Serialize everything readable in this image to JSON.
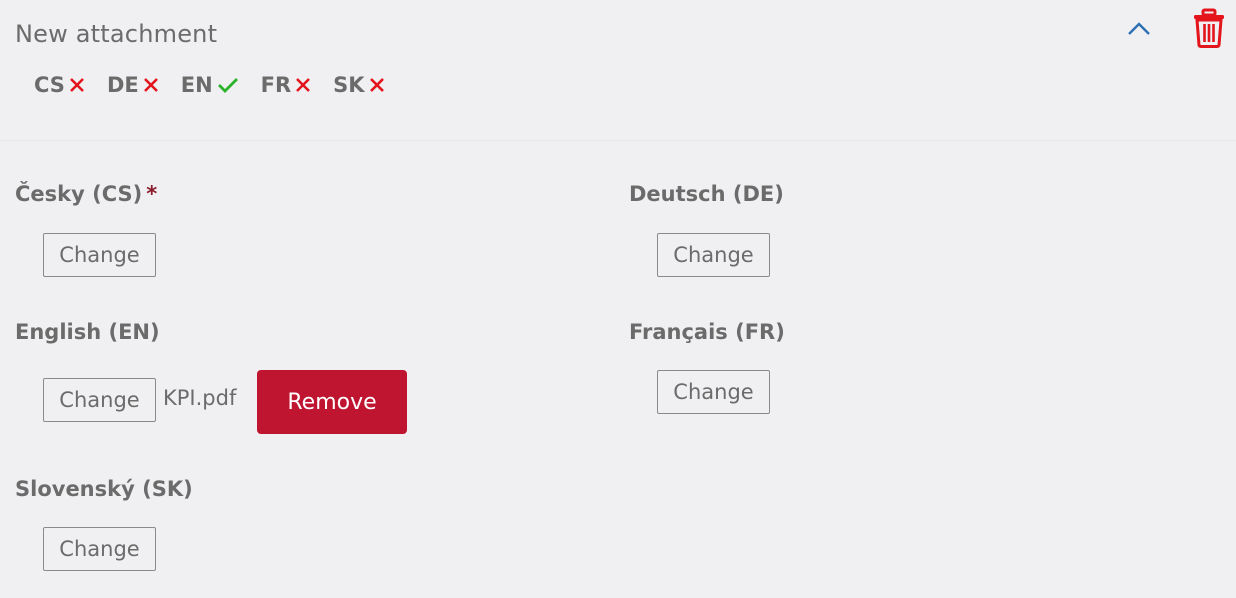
{
  "header": {
    "title": "New attachment",
    "collapse_icon": "chevron-up-icon",
    "delete_icon": "trash-icon",
    "accent_color": "#2f6fb3",
    "danger_color": "#e3141c"
  },
  "languages": [
    {
      "code": "CS",
      "status": "missing"
    },
    {
      "code": "DE",
      "status": "missing"
    },
    {
      "code": "EN",
      "status": "ok"
    },
    {
      "code": "FR",
      "status": "missing"
    },
    {
      "code": "SK",
      "status": "missing"
    }
  ],
  "status_colors": {
    "ok": "#2bb32b",
    "missing": "#e3141c"
  },
  "fields": {
    "cs": {
      "label": "Česky (CS)",
      "required_mark": "*",
      "button": "Change"
    },
    "de": {
      "label": "Deutsch (DE)",
      "button": "Change"
    },
    "en": {
      "label": "English (EN)",
      "button": "Change",
      "filename": "KPI.pdf",
      "remove": "Remove"
    },
    "fr": {
      "label": "Français (FR)",
      "button": "Change"
    },
    "sk": {
      "label": "Slovenský (SK)",
      "button": "Change"
    }
  }
}
